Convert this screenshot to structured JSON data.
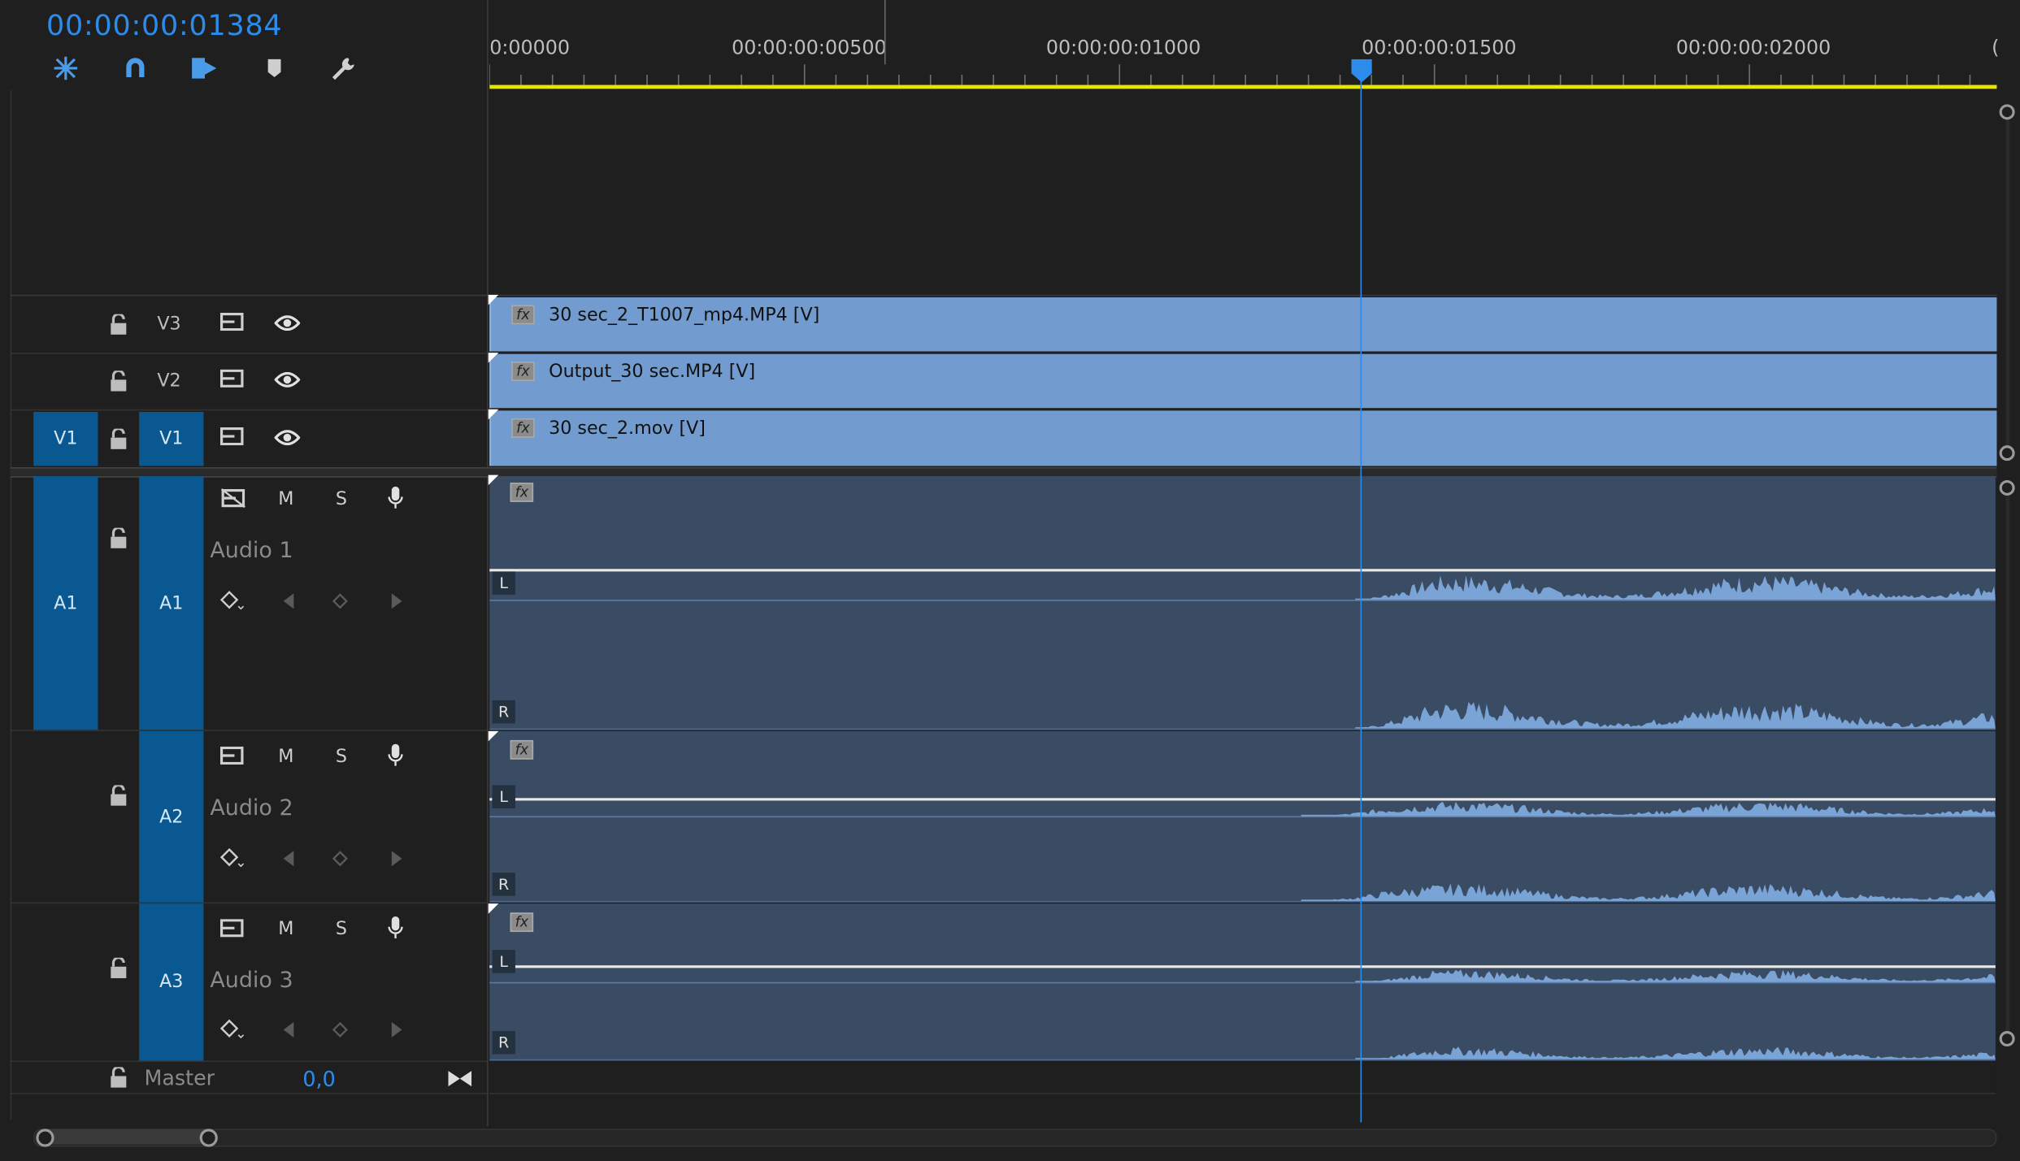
{
  "timecode": "00:00:00:01384",
  "toolbar": {
    "tools": [
      {
        "name": "snap-insert-tool",
        "glyph": "✲"
      },
      {
        "name": "magnet-snap-tool",
        "glyph": "∩"
      },
      {
        "name": "linked-selection-tool",
        "glyph": "⧉"
      },
      {
        "name": "add-marker-tool",
        "glyph": "⬟"
      },
      {
        "name": "settings-wrench-tool",
        "glyph": "🔧"
      }
    ]
  },
  "ruler": {
    "labels": [
      "0:00000",
      "00:00:00:00500",
      "00:00:00:01000",
      "00:00:00:01500",
      "00:00:00:02000",
      "("
    ]
  },
  "video_tracks": [
    {
      "source": "",
      "target": "V3",
      "clip": "30 sec_2_T1007_mp4.MP4 [V]"
    },
    {
      "source": "",
      "target": "V2",
      "clip": "Output_30 sec.MP4 [V]"
    },
    {
      "source": "V1",
      "target": "V1",
      "clip": "30 sec_2.mov [V]"
    }
  ],
  "audio_tracks": [
    {
      "source": "A1",
      "target": "A1",
      "name": "Audio 1",
      "m": "M",
      "s": "S"
    },
    {
      "source": "",
      "target": "A2",
      "name": "Audio 2",
      "m": "M",
      "s": "S"
    },
    {
      "source": "",
      "target": "A3",
      "name": "Audio 3",
      "m": "M",
      "s": "S"
    }
  ],
  "channels": {
    "left": "L",
    "right": "R"
  },
  "fx_label": "fx",
  "master": {
    "label": "Master",
    "value": "0,0"
  },
  "colors": {
    "accent_blue": "#2d8ceb",
    "track_tag_blue": "#0a5891",
    "video_clip": "#729bcf",
    "audio_clip": "#3a4c64",
    "waveform": "#7aa3d6",
    "work_area_bar": "#e6e600"
  }
}
